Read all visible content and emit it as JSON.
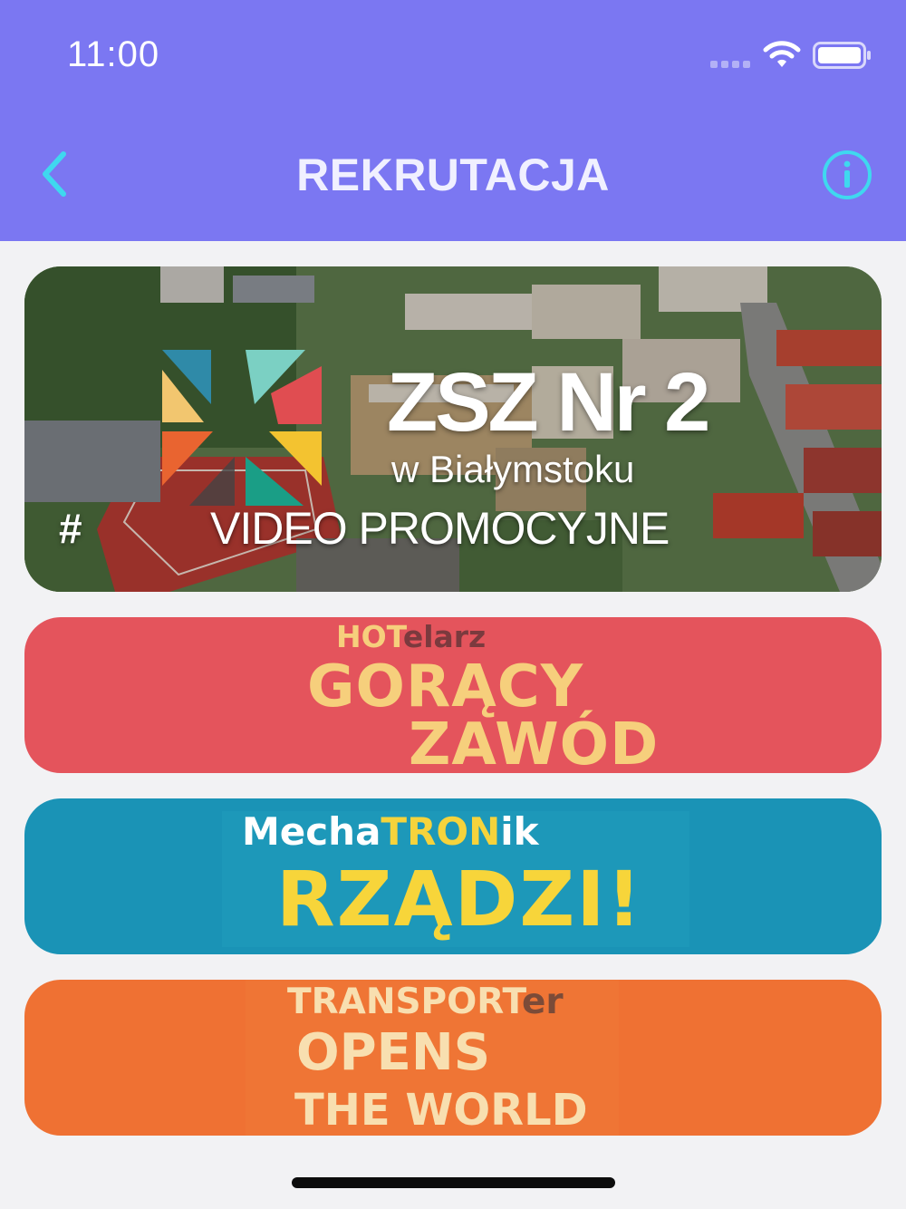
{
  "status_bar": {
    "time": "11:00",
    "icons": [
      "signal-dots-icon",
      "wifi-icon",
      "battery-icon"
    ]
  },
  "header": {
    "title": "REKRUTACJA",
    "back_icon": "chevron-left-icon",
    "info_icon": "info-circle-icon",
    "background_color": "#7b77f2",
    "accent_color": "#3fd8ef"
  },
  "cards": {
    "promo": {
      "title": "ZSZ Nr 2",
      "subtitle": "w Białymstoku",
      "hash": "#",
      "tagline": "VIDEO PROMOCYJNE"
    },
    "hotel": {
      "top_a": "HOT",
      "top_b": "elarz",
      "line1": "GORĄCY",
      "line2": "ZAWÓD",
      "color": "#e4545c"
    },
    "mecha": {
      "top_a": "Mecha",
      "top_b": "TRON",
      "top_c": "ik",
      "main": "RZĄDZI!",
      "color": "#1a93b6"
    },
    "transport": {
      "top_a": "TRANSPORT",
      "top_b": "er",
      "line1": "OPENS",
      "line2": "THE WORLD",
      "color": "#ef7133"
    }
  }
}
